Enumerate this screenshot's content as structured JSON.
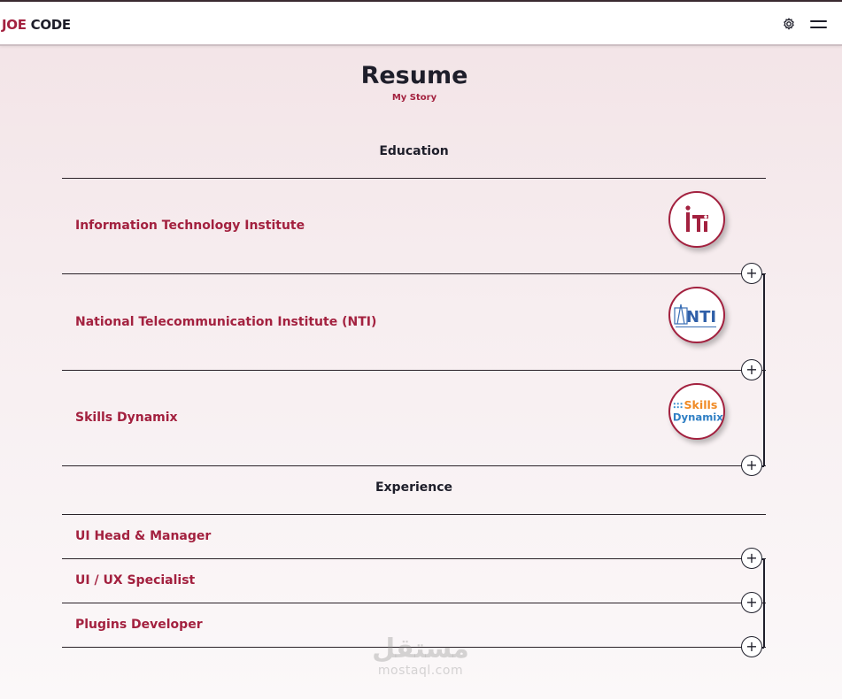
{
  "header": {
    "logo_part1": "JOE",
    "logo_part2": " CODE",
    "settings_icon": "gear-icon",
    "menu_icon": "hamburger-menu-icon"
  },
  "page": {
    "title": "Resume",
    "subtitle": "My Story"
  },
  "education": {
    "heading": "Education",
    "items": [
      {
        "label": "Information Technology Institute",
        "logo": "iti-logo",
        "logo_text": "iTi"
      },
      {
        "label": "National Telecommunication Institute (NTI)",
        "logo": "nti-logo",
        "logo_text": "NTI"
      },
      {
        "label": "Skills Dynamix",
        "logo": "skills-dynamix-logo",
        "logo_text_1": "Skills",
        "logo_text_2": "Dynamix"
      }
    ]
  },
  "experience": {
    "heading": "Experience",
    "items": [
      {
        "label": "UI Head & Manager"
      },
      {
        "label": "UI / UX Specialist"
      },
      {
        "label": "Plugins Developer"
      }
    ]
  },
  "expand_symbol": "+",
  "watermark": {
    "arabic": "مستقل",
    "domain": "mostaql.com"
  },
  "colors": {
    "accent": "#a3213f",
    "text": "#1e1e2a",
    "background_top": "#f2e3e6",
    "background_bottom": "#fbf8f9"
  }
}
